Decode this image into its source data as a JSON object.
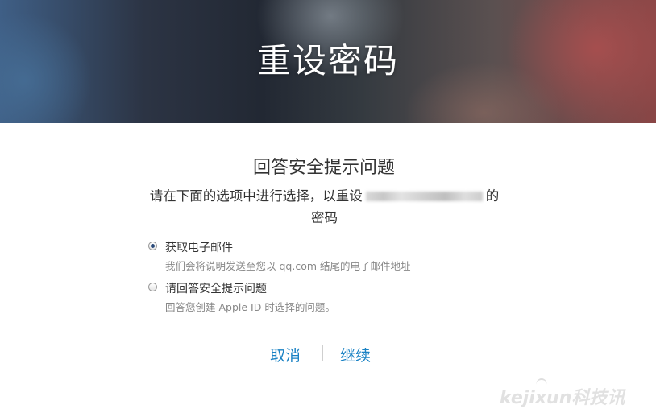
{
  "hero": {
    "title": "重设密码"
  },
  "section": {
    "title": "回答安全提示问题"
  },
  "instruction": {
    "text_before": "请在下面的选项中进行选择，以重设",
    "text_after": "的",
    "text_line2": "密码"
  },
  "options": [
    {
      "label": "获取电子邮件",
      "description": "我们会将说明发送至您以 qq.com 结尾的电子邮件地址",
      "selected": true
    },
    {
      "label": "请回答安全提示问题",
      "description": "回答您创建 Apple ID 时选择的问题。",
      "selected": false
    }
  ],
  "actions": {
    "cancel_label": "取消",
    "continue_label": "继续"
  },
  "watermark": {
    "text": "kejixun科技讯"
  },
  "colors": {
    "link": "#1a82c4",
    "radio_dot": "#2a4a7a"
  }
}
